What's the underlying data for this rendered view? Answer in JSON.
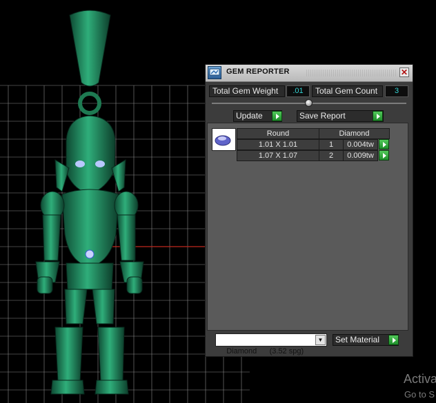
{
  "panel": {
    "title": "GEM REPORTER",
    "close_glyph": "✕",
    "title_icon": "gem-reporter-icon",
    "total_weight_label": "Total Gem Weight",
    "total_weight_value": ".01",
    "total_count_label": "Total Gem Count",
    "total_count_value": "3",
    "update_label": "Update",
    "save_report_label": "Save Report",
    "table": {
      "headers": [
        "Round",
        "Diamond"
      ],
      "rows": [
        {
          "size": "1.01 X 1.01",
          "count": "1",
          "weight": "0.004tw"
        },
        {
          "size": "1.07 X 1.07",
          "count": "2",
          "weight": "0.009tw"
        }
      ]
    },
    "material_select": "Diamond      (3.52 spg)",
    "set_material_label": "Set Material"
  },
  "watermark": {
    "line1": "Activa",
    "line2": "Go to S"
  },
  "colors": {
    "model": "#1f8a5e",
    "grid": "#8a8a8a",
    "axis_red": "#c0281e",
    "value_text": "#35d4d4",
    "go_button": "#2fa83a"
  }
}
